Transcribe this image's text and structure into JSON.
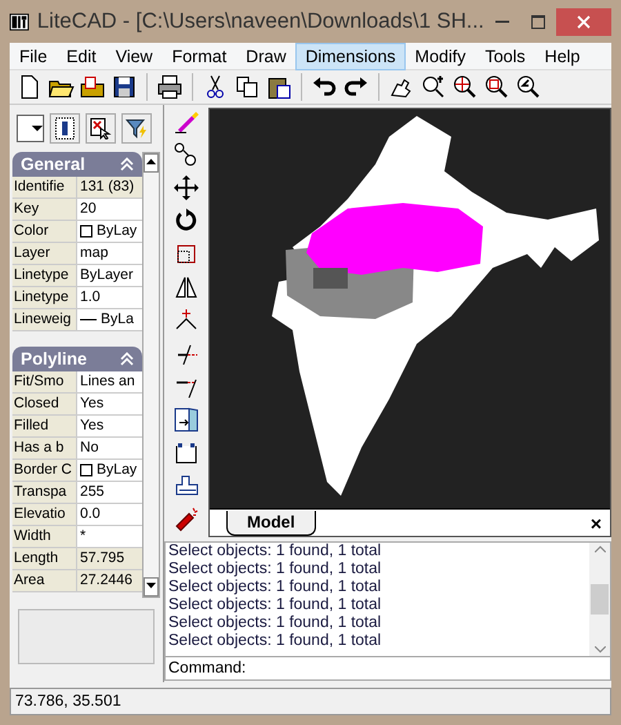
{
  "window": {
    "title": "LiteCAD - [C:\\Users\\naveen\\Downloads\\1 SH..."
  },
  "menu": [
    {
      "label": "File",
      "selected": false
    },
    {
      "label": "Edit",
      "selected": false
    },
    {
      "label": "View",
      "selected": false
    },
    {
      "label": "Format",
      "selected": false
    },
    {
      "label": "Draw",
      "selected": false
    },
    {
      "label": "Dimensions",
      "selected": true
    },
    {
      "label": "Modify",
      "selected": false
    },
    {
      "label": "Tools",
      "selected": false
    },
    {
      "label": "Help",
      "selected": false
    }
  ],
  "properties": [
    {
      "title": "General",
      "expanded": true,
      "rows": [
        {
          "label": "Identifie",
          "value": "131 (83)",
          "kind": "text",
          "readonly": true
        },
        {
          "label": "Key",
          "value": "20",
          "kind": "text",
          "readonly": false
        },
        {
          "label": "Color",
          "value": "ByLay",
          "kind": "swatch",
          "readonly": false
        },
        {
          "label": "Layer",
          "value": "map",
          "kind": "text",
          "readonly": false
        },
        {
          "label": "Linetype",
          "value": "ByLayer",
          "kind": "text",
          "readonly": false
        },
        {
          "label": "Linetype",
          "value": "1.0",
          "kind": "text",
          "readonly": false
        },
        {
          "label": "Lineweig",
          "value": "ByLa",
          "kind": "weight",
          "readonly": false
        }
      ]
    },
    {
      "title": "Polyline",
      "expanded": true,
      "rows": [
        {
          "label": "Fit/Smo",
          "value": "Lines an",
          "kind": "text",
          "readonly": false
        },
        {
          "label": "Closed",
          "value": "Yes",
          "kind": "text",
          "readonly": false
        },
        {
          "label": "Filled",
          "value": "Yes",
          "kind": "text",
          "readonly": false
        },
        {
          "label": "Has a b",
          "value": "No",
          "kind": "text",
          "readonly": false
        },
        {
          "label": "Border C",
          "value": "ByLay",
          "kind": "swatch",
          "readonly": false
        },
        {
          "label": "Transpa",
          "value": "255",
          "kind": "text",
          "readonly": false
        },
        {
          "label": "Elevatio",
          "value": "0.0",
          "kind": "text",
          "readonly": false
        },
        {
          "label": "Width",
          "value": "*",
          "kind": "text",
          "readonly": false
        },
        {
          "label": "Length",
          "value": "57.795",
          "kind": "text",
          "readonly": true
        },
        {
          "label": "Area",
          "value": "27.2446",
          "kind": "text",
          "readonly": true
        }
      ]
    }
  ],
  "tabs": [
    {
      "label": "Model",
      "selected": true
    }
  ],
  "tab_close": "×",
  "log": [
    "Select objects: 1 found,  1 total",
    "Select objects: 1 found,  1 total",
    "Select objects: 1 found,  1 total",
    "Select objects: 1 found,  1 total",
    "Select objects: 1 found,  1 total",
    "Select objects: 1 found,  1 total"
  ],
  "command": {
    "label": "Command:"
  },
  "status_bar": "73.786,  35.501"
}
